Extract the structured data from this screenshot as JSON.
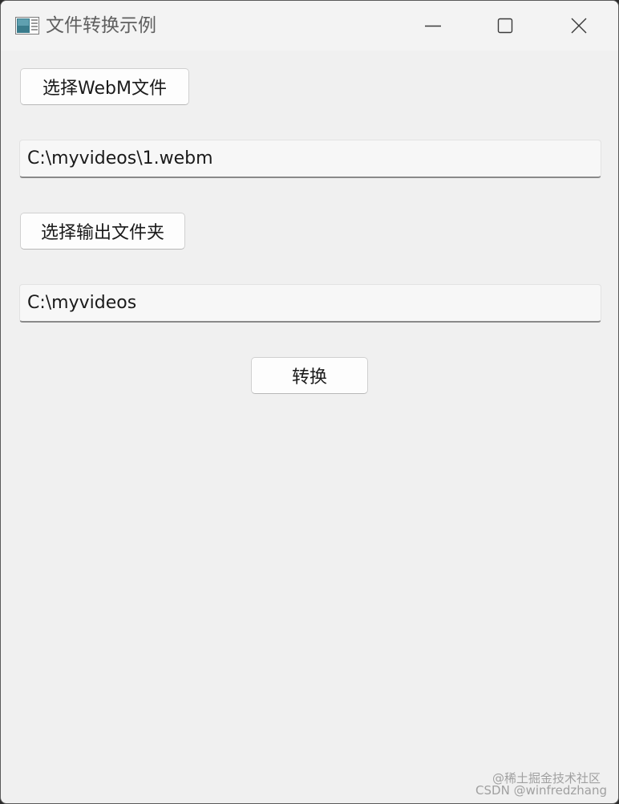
{
  "window": {
    "title": "文件转换示例"
  },
  "controls": {
    "select_webm_label": "选择WebM文件",
    "input_path_value": "C:\\myvideos\\1.webm",
    "select_output_label": "选择输出文件夹",
    "output_path_value": "C:\\myvideos",
    "convert_label": "转换"
  },
  "watermark": {
    "line1": "@稀土掘金技术社区",
    "line2": "CSDN @winfredzhang"
  },
  "colors": {
    "window_bg": "#f0f0f0",
    "titlebar_bg": "#f3f3f3",
    "title_text": "#5f5f5f"
  },
  "icons": {
    "app": "app-window-icon",
    "minimize": "minimize-icon",
    "maximize": "maximize-icon",
    "close": "close-icon"
  }
}
